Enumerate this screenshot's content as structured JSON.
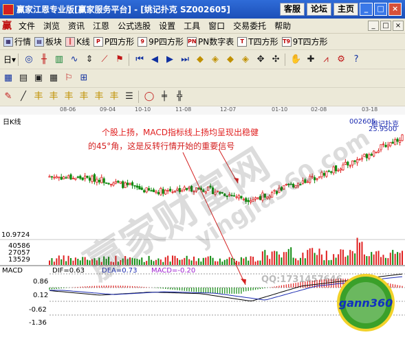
{
  "window": {
    "title": "赢家江恩专业版[赢家服务平台] - [姚记扑克   SZ002605]",
    "buttons": [
      "客服",
      "论坛",
      "主页"
    ],
    "controls": [
      "_",
      "□",
      "×"
    ]
  },
  "menu": {
    "items": [
      "文件",
      "浏览",
      "资讯",
      "江恩",
      "公式选股",
      "设置",
      "工具",
      "窗口",
      "交易委托",
      "帮助"
    ],
    "mdi_controls": [
      "_",
      "□",
      "×"
    ]
  },
  "toolbar1": {
    "items": [
      "行情",
      "板块",
      "K线",
      "P四方形",
      "9P四方形",
      "PN数字表",
      "T四方形",
      "9T四方形"
    ]
  },
  "toolbar2": {
    "first_label": "日"
  },
  "dates": [
    "08-06",
    "09-04",
    "10-10",
    "11-08",
    "12-07",
    "01-10",
    "02-08",
    "03-18"
  ],
  "chart": {
    "period_label": "日K线",
    "stock_code": "002605",
    "stock_name": "姚记扑克",
    "price_label": "25.9500",
    "annotation_line1": "个股上扬，MACD指标线上扬均呈现出稳健",
    "annotation_line2": "的45°角，这是反转行情开始的重要信号",
    "annotation_color": "#d42020",
    "price_min_label": "10.9724",
    "volume_labels": [
      "40586",
      "27057",
      "13529"
    ],
    "macd": {
      "title": "MACD",
      "dif_label": "DIF=0.63",
      "dea_label": "DEA=0.73",
      "macd_label": "MACD=-0.20",
      "axis_labels": [
        "0.86",
        "0.12",
        "-0.62",
        "-1.36"
      ]
    },
    "watermark": {
      "text1": "赢家财富网",
      "text2": "yingjia360.com",
      "qq": "QQ:1731457646"
    }
  },
  "logo": {
    "text": "gann360"
  },
  "colors": {
    "up": "#e02020",
    "down": "#108a10",
    "dif": "#000000",
    "dea": "#1a2ab0",
    "macd_text": "#a020d0"
  },
  "chart_data": {
    "type": "candlestick",
    "x": [
      "08-06",
      "09-04",
      "10-10",
      "11-08",
      "12-07",
      "01-10",
      "02-08",
      "03-18"
    ],
    "price_trend": [
      19.0,
      18.6,
      16.8,
      17.3,
      15.6,
      18.2,
      21.0,
      24.8
    ],
    "macd_dif_trend": [
      -0.2,
      -0.5,
      -0.3,
      -0.4,
      -0.9,
      0.1,
      0.5,
      0.9
    ],
    "price_min": 10.9724,
    "stock": "姚记扑克 002605"
  }
}
